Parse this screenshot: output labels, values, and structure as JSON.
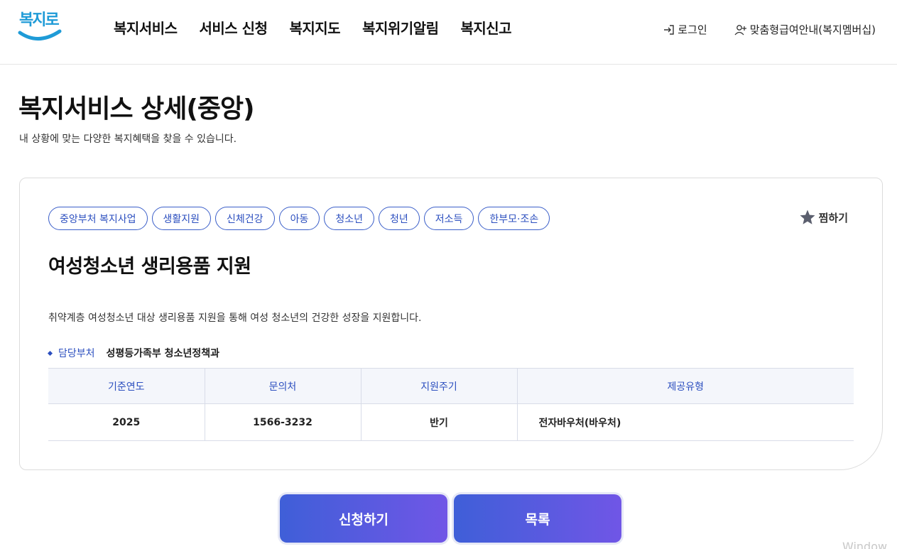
{
  "header": {
    "logo_text": "복지로",
    "nav": [
      "복지서비스",
      "서비스 신청",
      "복지지도",
      "복지위기알림",
      "복지신고"
    ],
    "login_label": "로그인",
    "membership_label": "맞춤형급여안내(복지멤버십)"
  },
  "page": {
    "title": "복지서비스 상세(중앙)",
    "description": "내 상황에 맞는 다양한 복지혜택을 찾을 수 있습니다."
  },
  "service": {
    "tags": [
      "중앙부처 복지사업",
      "생활지원",
      "신체건강",
      "아동",
      "청소년",
      "청년",
      "저소득",
      "한부모·조손"
    ],
    "favorite_label": "찜하기",
    "title": "여성청소년 생리용품 지원",
    "description": "취약계층 여성청소년 대상 생리용품 지원을 통해 여성 청소년의 건강한 성장을 지원합니다.",
    "dept_label": "담당부처",
    "dept_value": "성평등가족부 청소년정책과",
    "table": {
      "headers": [
        "기준연도",
        "문의처",
        "지원주기",
        "제공유형"
      ],
      "row": [
        "2025",
        "1566-3232",
        "반기",
        "전자바우처(바우처)"
      ]
    }
  },
  "actions": {
    "apply_label": "신청하기",
    "list_label": "목록"
  },
  "watermark": "Window"
}
